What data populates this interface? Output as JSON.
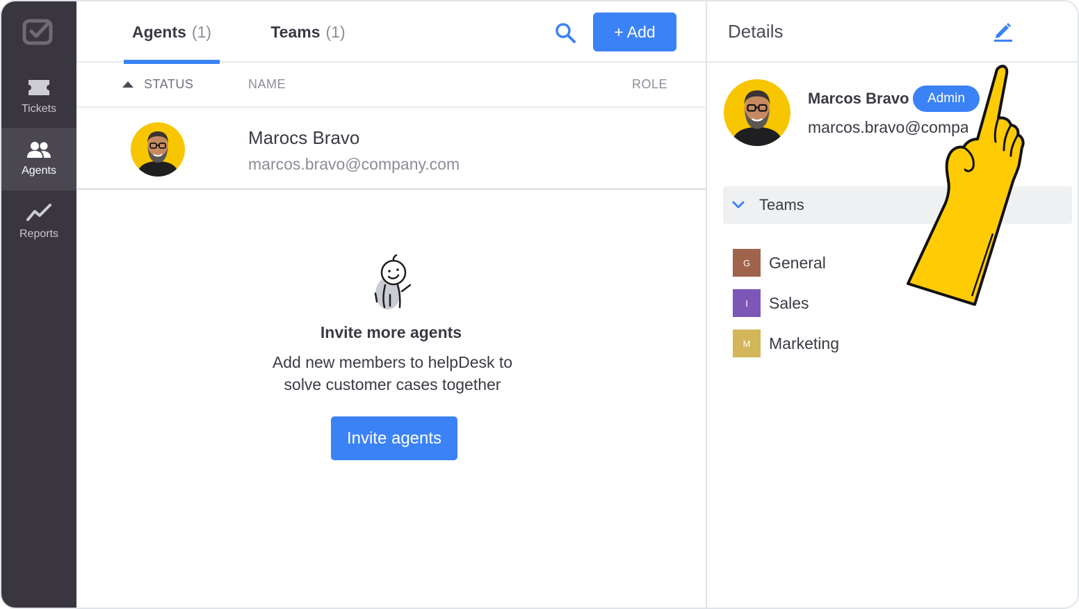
{
  "sidebar": {
    "items": [
      {
        "label": "Tickets",
        "icon": "ticket-icon"
      },
      {
        "label": "Agents",
        "icon": "agents-icon",
        "active": true
      },
      {
        "label": "Reports",
        "icon": "chart-line-icon"
      }
    ]
  },
  "tabs": {
    "agents_label": "Agents",
    "agents_count": "(1)",
    "teams_label": "Teams",
    "teams_count": "(1)"
  },
  "toolbar": {
    "add_label": "+ Add",
    "search_icon": "search-icon"
  },
  "table": {
    "headers": {
      "status": "STATUS",
      "name": "NAME",
      "role": "ROLE"
    },
    "rows": [
      {
        "name": "Marocs Bravo",
        "email": "marcos.bravo@company.com"
      }
    ]
  },
  "empty_state": {
    "title": "Invite more agents",
    "text": "Add new members to helpDesk to solve customer cases together",
    "button": "Invite agents"
  },
  "details": {
    "title": "Details",
    "name": "Marcos Bravo",
    "badge": "Admin",
    "email": "marcos.bravo@company.com",
    "teams_label": "Teams",
    "teams": [
      {
        "initial": "G",
        "name": "General",
        "color": "#a0634b"
      },
      {
        "initial": "I",
        "name": "Sales",
        "color": "#7c57b8"
      },
      {
        "initial": "M",
        "name": "Marketing",
        "color": "#d3b65a"
      }
    ]
  },
  "colors": {
    "accent": "#3b82f6",
    "sidebar": "#3a3640",
    "avatar_bg": "#f7c600"
  }
}
